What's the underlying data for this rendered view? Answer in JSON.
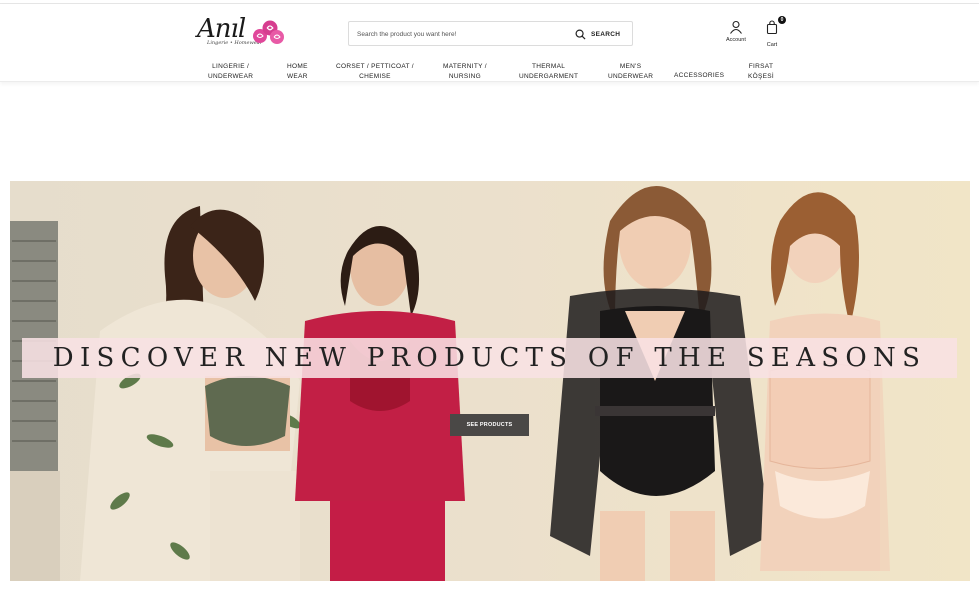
{
  "header": {
    "logo_text": "Anıl",
    "logo_tagline": "Lingerie • Homewear",
    "search": {
      "placeholder": "Search the product you want here!",
      "button_label": "SEARCH"
    },
    "account": {
      "label": "Account",
      "icon": "user-icon"
    },
    "cart": {
      "label": "Cart",
      "count": "0",
      "icon": "shopping-bag-icon"
    }
  },
  "nav": {
    "items": [
      {
        "line1": "LINGERIE /",
        "line2": "UNDERWEAR"
      },
      {
        "line1": "HOME",
        "line2": "WEAR"
      },
      {
        "line1": "CORSET / PETTICOAT /",
        "line2": "CHEMISE"
      },
      {
        "line1": "MATERNITY /",
        "line2": "NURSING"
      },
      {
        "line1": "THERMAL",
        "line2": "UNDERGARMENT"
      },
      {
        "line1": "MEN'S",
        "line2": "UNDERWEAR"
      },
      {
        "line1": "ACCESSORIES",
        "line2": ""
      },
      {
        "line1": "FIRSAT",
        "line2": "KÖŞESİ"
      }
    ]
  },
  "hero": {
    "headline": "DISCOVER NEW PRODUCTS OF THE SEASONS",
    "button_label": "SEE PRODUCTS"
  },
  "colors": {
    "logo_accent": "#e0479a",
    "banner_strip": "#f8e1e4",
    "cta_bg": "#4a4846"
  }
}
